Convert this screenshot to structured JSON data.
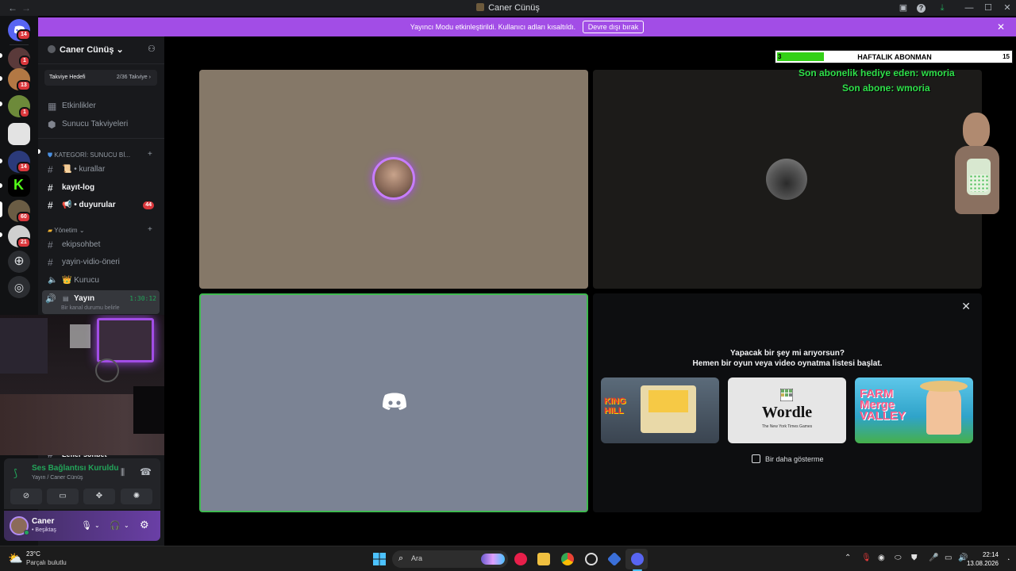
{
  "window": {
    "title": "Caner Cünüş",
    "back": "←",
    "forward": "→",
    "minimize": "—",
    "maximize": "☐",
    "close": "✕"
  },
  "notice": {
    "text": "Yayıncı Modu etkinleştirildi. Kullanıcı adları kısaltıldı.",
    "button": "Devre dışı bırak",
    "close": "✕"
  },
  "rail": {
    "badges": [
      "14",
      "1",
      "13",
      "1",
      "14",
      "60",
      "21"
    ]
  },
  "sidebar": {
    "server_name": "Caner Cünüş",
    "chevron": "⌄",
    "boost": {
      "label": "Takviye Hedefi",
      "count": "2/36 Takviye",
      "arrow": "›"
    },
    "top_items": [
      {
        "label": "Etkinlikler"
      },
      {
        "label": "Sunucu Takviyeleri"
      }
    ],
    "category1": "KATEGORİ: SUNUCU Bİ...",
    "channels1": [
      {
        "label": "📜 • kurallar"
      },
      {
        "label": "kayıt-log"
      },
      {
        "label": "📢 • duyurular",
        "mentions": "44"
      }
    ],
    "category2": "Yönetim",
    "channels2": [
      {
        "label": "ekipsohbet"
      },
      {
        "label": "yayin-vidio-öneri"
      },
      {
        "label": "👑 Kurucu"
      }
    ],
    "voice_channel": {
      "label": "Yayın",
      "time": "1:30:12",
      "status": "Bir kanal durumu belirle"
    },
    "hidden_channel": "Lefler sohbet"
  },
  "voice_panel": {
    "status": "Ses Bağlantısı Kuruldu",
    "sub": "Yayın / Caner Cünüş"
  },
  "user_panel": {
    "name": "Caner",
    "status": "• Beşiktaş"
  },
  "overlay": {
    "sub_current": "3",
    "sub_label": "HAFTALIK ABONMAN",
    "sub_goal": "15",
    "sub_progress": 0.2,
    "line1": "Son abonelik hediye eden: wmoria",
    "line2": "Son abone: wmoria"
  },
  "activity": {
    "question": "Yapacak bir şey mi arıyorsun?",
    "subtitle": "Hemen bir oyun veya video oynatma listesi başlat.",
    "cards": [
      "KING HILL",
      "Wordle",
      "FARM Merge VALLEY"
    ],
    "wordle_sub": "The New York Times Games",
    "dont_show": "Bir daha gösterme",
    "close": "✕"
  },
  "taskbar": {
    "temp": "23°C",
    "weather": "Parçalı bulutlu",
    "search": "Ara",
    "time": "22:14",
    "date": "13.08.2026"
  }
}
